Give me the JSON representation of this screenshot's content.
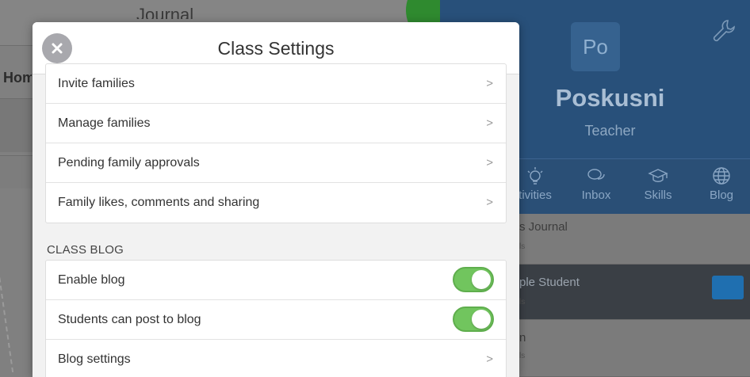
{
  "background": {
    "journal_title": "Journal",
    "home_label": "Hom",
    "avatar_initials": "Po",
    "profile_name": "Poskusni",
    "profile_role": "Teacher",
    "nav": [
      {
        "label": "tivities",
        "icon": "lightbulb-icon"
      },
      {
        "label": "Inbox",
        "icon": "chat-bubbles-icon"
      },
      {
        "label": "Skills",
        "icon": "graduation-cap-icon"
      },
      {
        "label": "Blog",
        "icon": "globe-icon"
      }
    ],
    "list": [
      {
        "title": "s Journal",
        "sub": "ls"
      },
      {
        "title": "ple Student",
        "sub": "ls"
      },
      {
        "title": "n",
        "sub": "ls"
      }
    ]
  },
  "modal": {
    "title": "Class Settings",
    "close_icon": "close-icon",
    "family_items": [
      {
        "label": "Invite families",
        "chevron": ">"
      },
      {
        "label": "Manage families",
        "chevron": ">"
      },
      {
        "label": "Pending family approvals",
        "chevron": ">"
      },
      {
        "label": "Family likes, comments and sharing",
        "chevron": ">"
      }
    ],
    "blog_section_label": "CLASS BLOG",
    "blog_items": [
      {
        "label": "Enable blog",
        "toggle_on": true
      },
      {
        "label": "Students can post to blog",
        "toggle_on": true
      },
      {
        "label": "Blog settings",
        "chevron": ">"
      }
    ]
  },
  "colors": {
    "toggle_on": "#71c55e",
    "profile_bg": "#28507a",
    "overlay": "#808080"
  }
}
